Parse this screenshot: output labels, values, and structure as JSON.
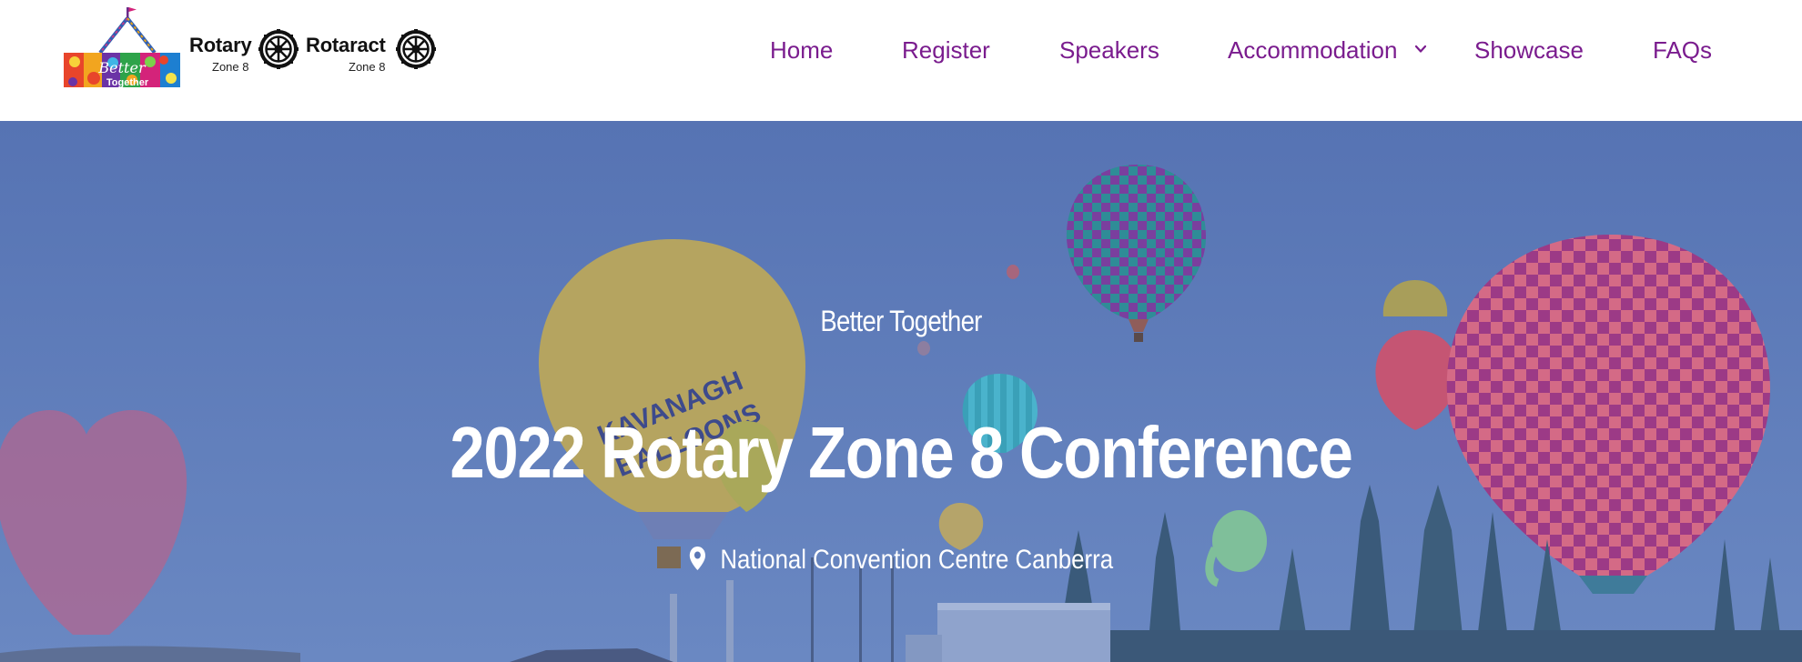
{
  "header": {
    "logo": {
      "badge_text": "Better Together",
      "brands": [
        {
          "name": "Rotary",
          "zone": "Zone 8"
        },
        {
          "name": "Rotaract",
          "zone": "Zone 8"
        }
      ]
    },
    "nav": {
      "items": [
        {
          "label": "Home"
        },
        {
          "label": "Register"
        },
        {
          "label": "Speakers"
        },
        {
          "label": "Accommodation",
          "icon": "chevron-down-icon"
        },
        {
          "label": "Showcase"
        },
        {
          "label": "FAQs"
        }
      ]
    }
  },
  "hero": {
    "tagline": "Better Together",
    "title": "2022 Rotary Zone 8 Conference",
    "venue": "National Convention Centre Canberra",
    "venue_icon": "location-pin-icon",
    "overlay_color": "#5a77b6",
    "balloon_text": "KAVANAGH BALLOONS"
  },
  "colors": {
    "nav_text": "#7a1c8e",
    "header_bg": "#ffffff",
    "hero_text": "#ffffff"
  }
}
